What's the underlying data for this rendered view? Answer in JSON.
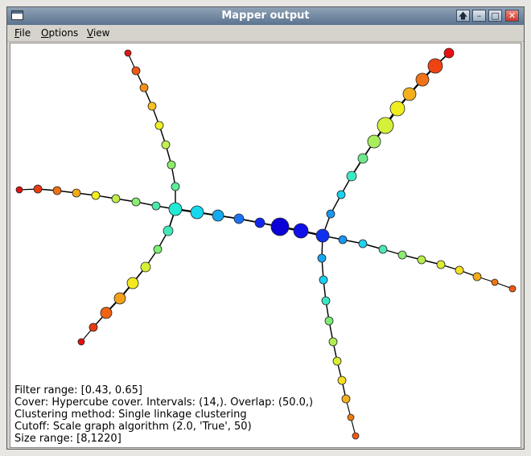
{
  "window": {
    "title": "Mapper output",
    "buttons": {
      "up": "🡅",
      "minimize": "–",
      "maximize": "□",
      "close": "✕"
    }
  },
  "menubar": {
    "file": "File",
    "options": "Options",
    "view": "View"
  },
  "info": {
    "filter_range": "Filter range: [0.43, 0.65]",
    "cover": "Cover: Hypercube cover. Intervals: (14,). Overlap: (50.0,)",
    "clustering": "Clustering method: Single linkage clustering",
    "cutoff": "Cutoff: Scale graph algorithm (2.0, 'True', 50)",
    "size_range": "Size range: [8,1220]"
  },
  "colors": {
    "titlebar": "#5b7390",
    "edge": "#000000"
  }
}
